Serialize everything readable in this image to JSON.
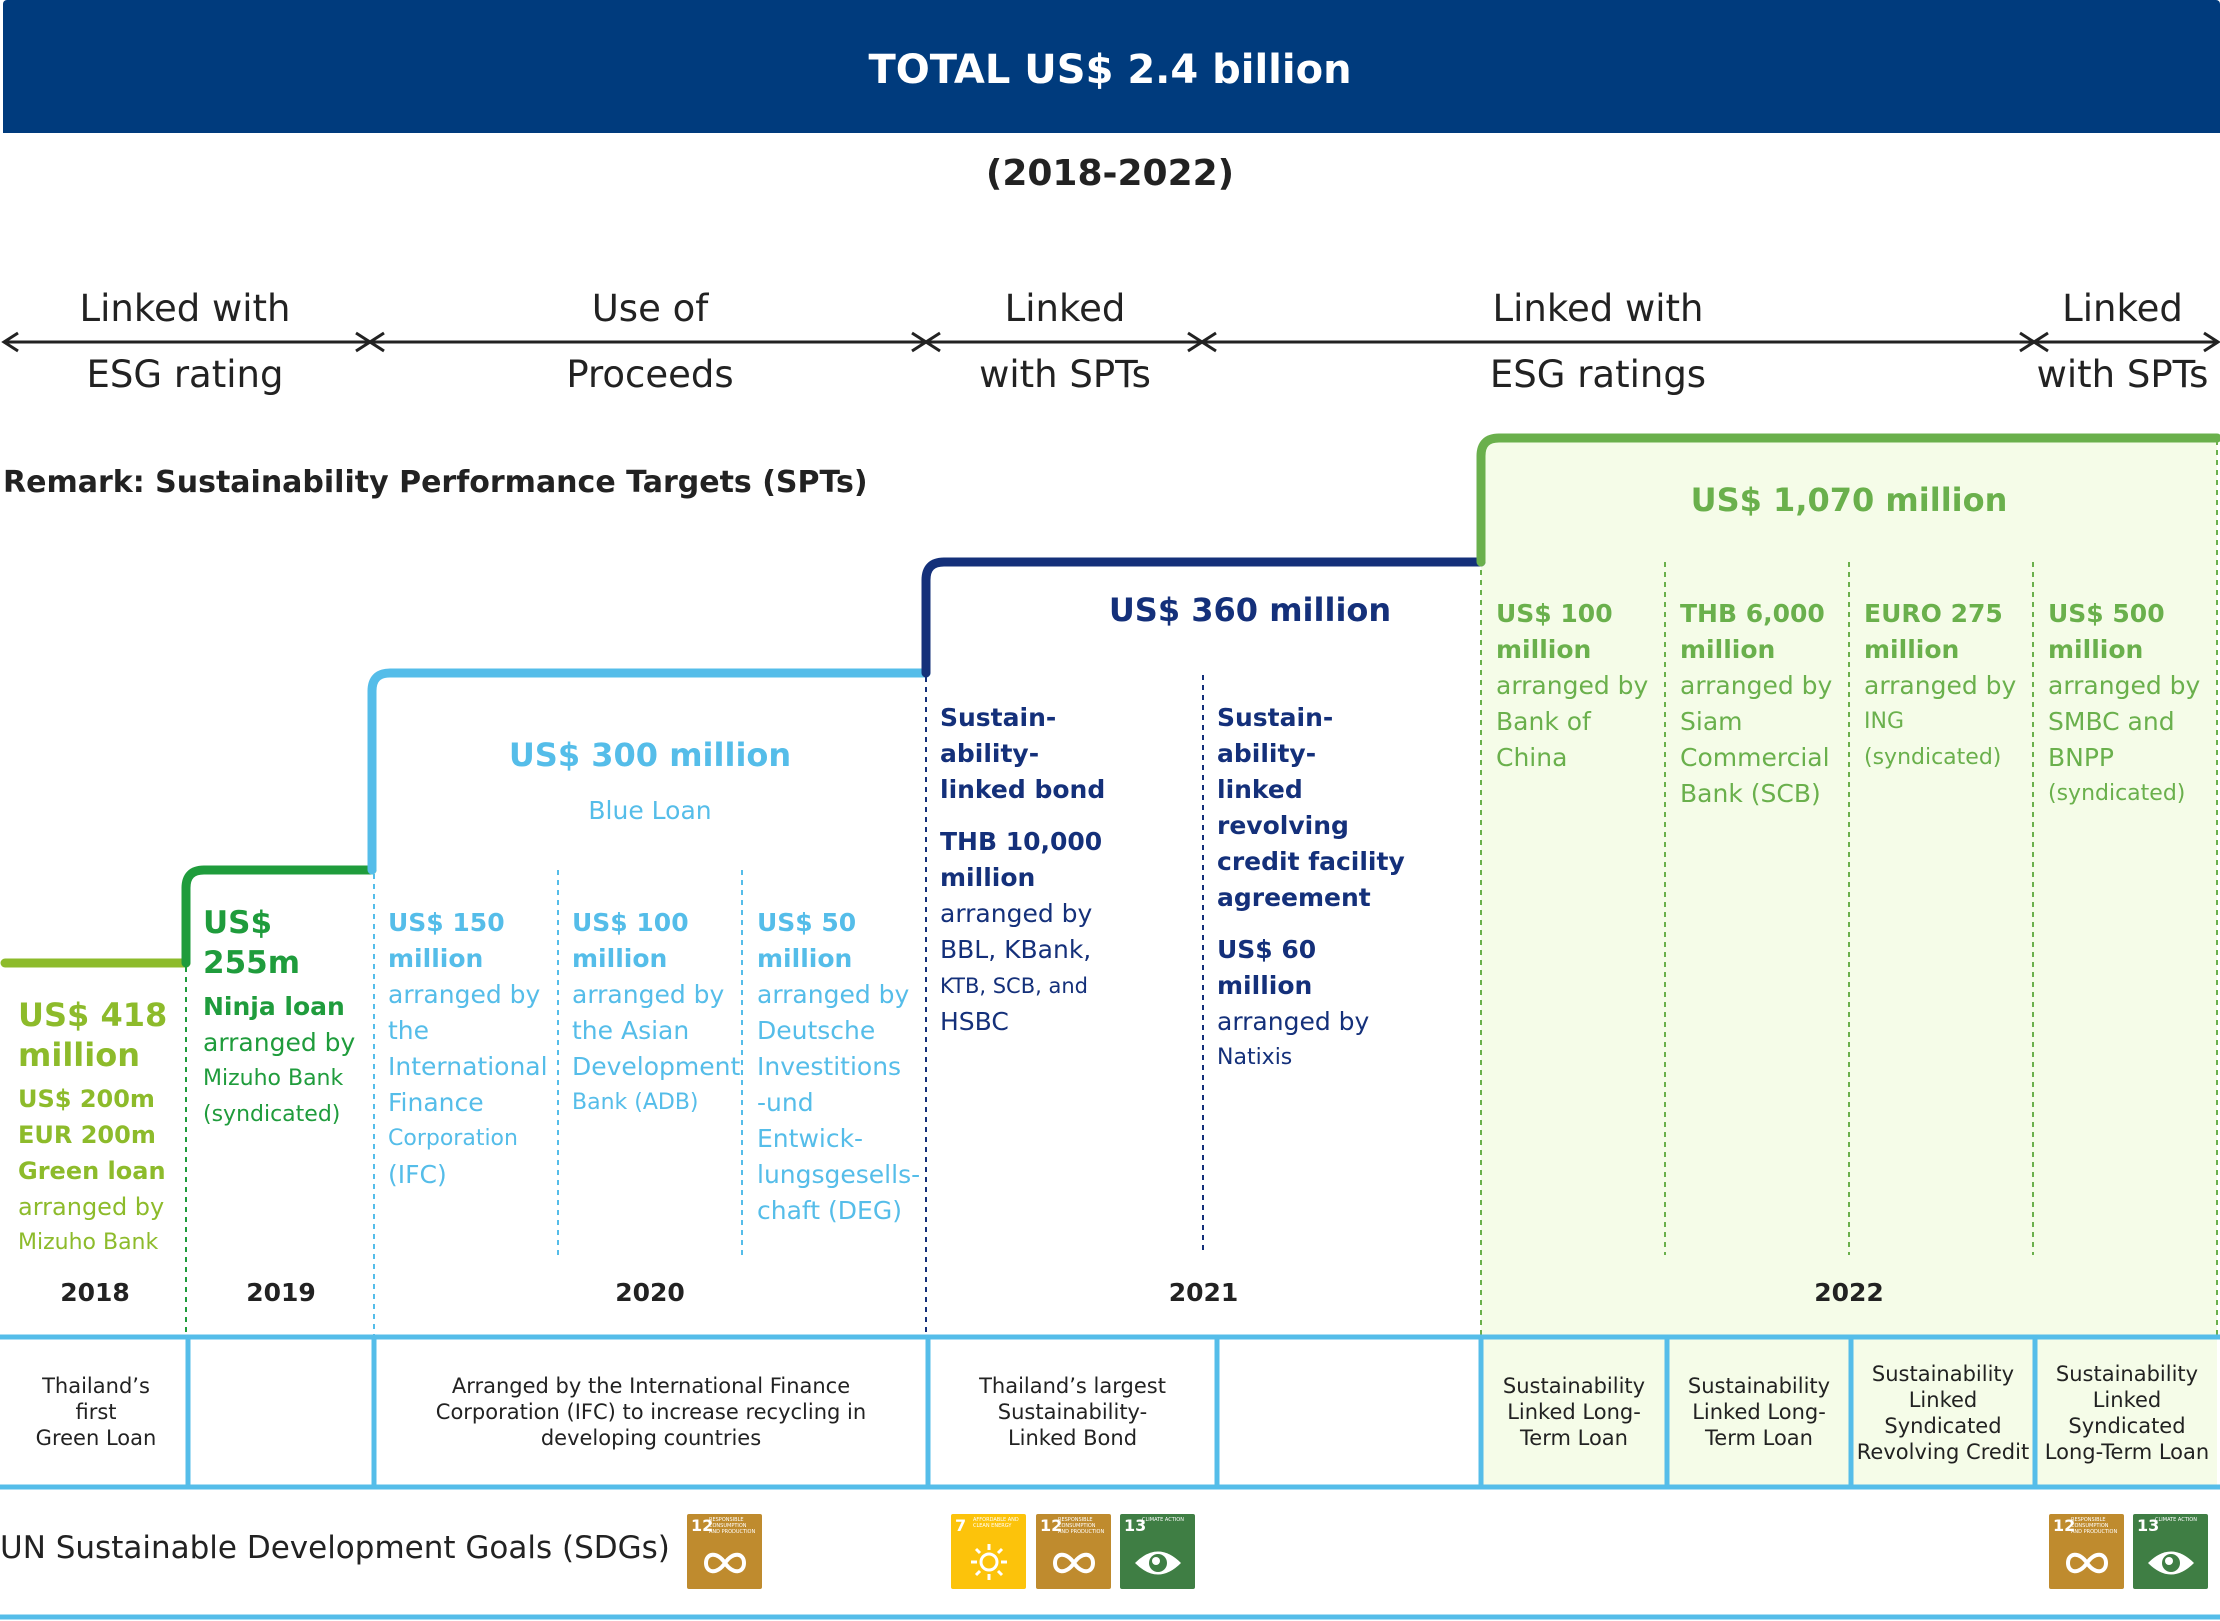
{
  "header": {
    "title": "TOTAL US$ 2.4 billion",
    "period": "(2018-2022)"
  },
  "phases": [
    {
      "l1": "Linked with",
      "l2": "ESG rating"
    },
    {
      "l1": "Use of",
      "l2": "Proceeds"
    },
    {
      "l1": "Linked",
      "l2": "with SPTs"
    },
    {
      "l1": "Linked with",
      "l2": "ESG ratings"
    },
    {
      "l1": "Linked",
      "l2": "with SPTs"
    }
  ],
  "remark": "Remark: Sustainability Performance Targets (SPTs)",
  "colors": {
    "banner": "#003b7d",
    "green_light": "#8dbb2b",
    "green_dark": "#1f9c3c",
    "blue_light": "#55bde9",
    "navy": "#14307a",
    "green_2022": "#6ab04c",
    "fill_2022": "#f5fce8",
    "table_line": "#55bde9"
  },
  "steps": {
    "y2018": {
      "total": "US$ 418",
      "total2": "million",
      "l1": "US$ 200m",
      "l2": "EUR 200m",
      "l3": "Green loan",
      "l4": "arranged by",
      "l5": "Mizuho Bank"
    },
    "y2019": {
      "total": "US$ 255m",
      "l1": "Ninja loan",
      "l2": "arranged by",
      "l3": "Mizuho Bank",
      "l4": "(syndicated)"
    },
    "y2020": {
      "total": "US$ 300 million",
      "type": "Blue Loan",
      "cols": [
        {
          "a1": "US$ 150",
          "a2": "million",
          "t": [
            "arranged by",
            "the",
            "International",
            "Finance",
            "Corporation",
            "(IFC)"
          ]
        },
        {
          "a1": "US$ 100",
          "a2": "million",
          "t": [
            "arranged by",
            "the Asian",
            "Development",
            "Bank (ADB)"
          ]
        },
        {
          "a1": "US$ 50",
          "a2": "million",
          "t": [
            "arranged by",
            "Deutsche",
            "Investitions",
            "-und Entwick-",
            "lungsgesells-",
            "chaft (DEG)"
          ]
        }
      ]
    },
    "y2021": {
      "total": "US$ 360 million",
      "col1": {
        "h": [
          "Sustain-",
          "ability-",
          "linked bond"
        ],
        "a": [
          "THB 10,000",
          "million"
        ],
        "t": [
          "arranged by",
          "BBL, KBank,",
          "KTB, SCB, and",
          "HSBC"
        ]
      },
      "col2": {
        "h": [
          "Sustain-",
          "ability-",
          "linked",
          "revolving",
          "credit facility",
          "agreement"
        ],
        "a": [
          "US$ 60",
          "million"
        ],
        "t": [
          "arranged by",
          "Natixis"
        ]
      }
    },
    "y2022": {
      "total": "US$ 1,070 million",
      "cols": [
        {
          "a1": "US$ 100",
          "a2": "million",
          "t": [
            "arranged by",
            "Bank of",
            "China"
          ]
        },
        {
          "a1": "THB 6,000",
          "a2": "million",
          "t": [
            "arranged by",
            "Siam",
            "Commercial",
            "Bank (SCB)"
          ]
        },
        {
          "a1": "EURO 275",
          "a2": "million",
          "t": [
            "arranged by",
            "ING",
            "(syndicated)"
          ]
        },
        {
          "a1": "US$ 500",
          "a2": "million",
          "t": [
            "arranged by",
            "SMBC and",
            "BNPP",
            "(syndicated)"
          ]
        }
      ]
    }
  },
  "years": [
    "2018",
    "2019",
    "2020",
    "2021",
    "2022"
  ],
  "descriptions": [
    [
      "Thailand’s",
      "first",
      "Green Loan"
    ],
    [],
    [
      "Arranged by the International Finance",
      "Corporation (IFC) to increase recycling in",
      "developing countries"
    ],
    [
      "Thailand’s largest",
      "Sustainability-",
      "Linked Bond"
    ],
    [],
    [
      "Sustainability",
      "Linked Long-",
      "Term Loan"
    ],
    [
      "Sustainability",
      "Linked Long-",
      "Term Loan"
    ],
    [
      "Sustainability",
      "Linked",
      "Syndicated",
      "Revolving Credit"
    ],
    [
      "Sustainability",
      "Linked",
      "Syndicated",
      "Long-Term Loan"
    ]
  ],
  "sdg": {
    "label": "UN Sustainable Development Goals (SDGs)",
    "g7": {
      "num": "7",
      "text": "AFFORDABLE AND CLEAN ENERGY",
      "color": "#fcc30b",
      "icon": "sun-icon"
    },
    "g12": {
      "num": "12",
      "text": "RESPONSIBLE CONSUMPTION AND PRODUCTION",
      "color": "#bf8b2e",
      "icon": "infinity-icon"
    },
    "g13": {
      "num": "13",
      "text": "CLIMATE ACTION",
      "color": "#3f7e44",
      "icon": "eye-globe-icon"
    }
  }
}
